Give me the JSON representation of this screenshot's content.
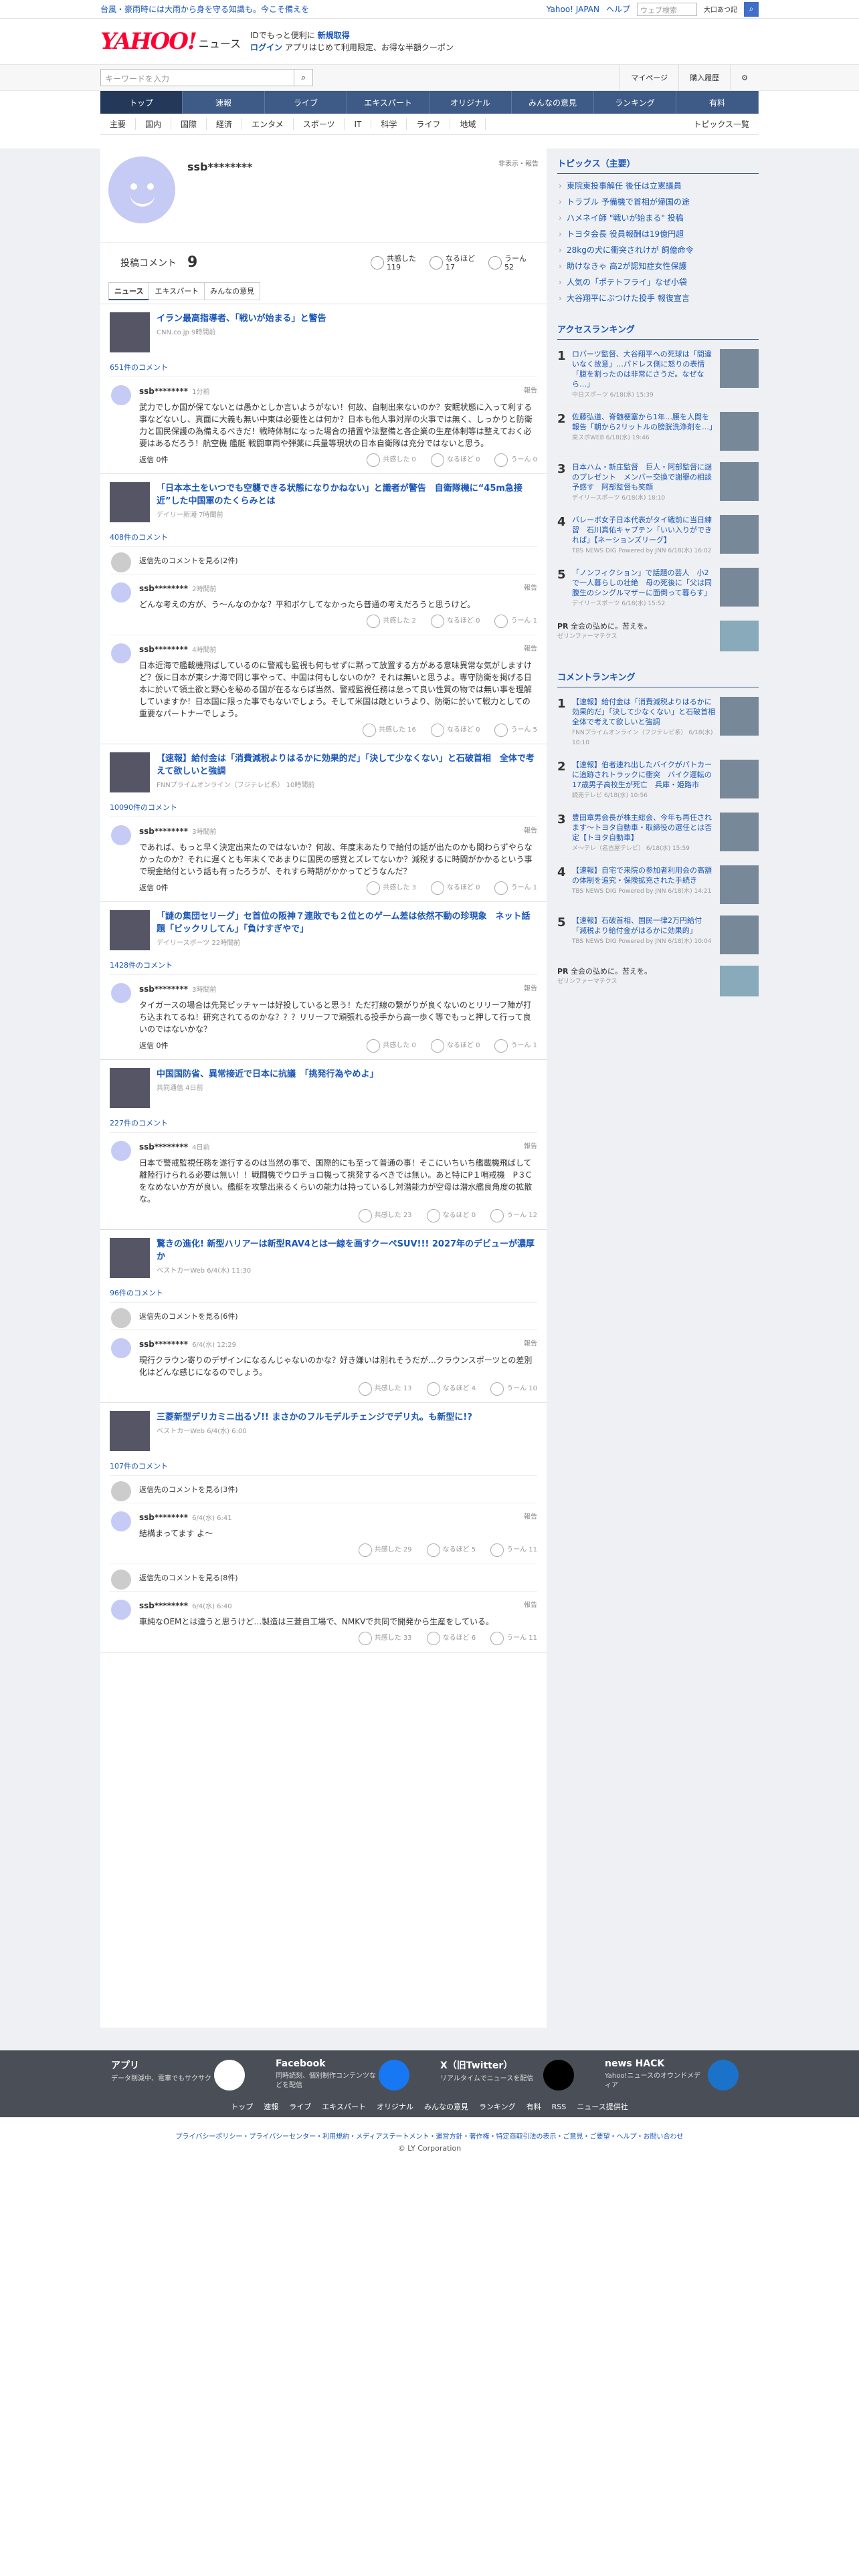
{
  "topbar": {
    "promo": "台風・豪雨時には大雨から身を守る知識も。今こそ備えを",
    "links": [
      "Yahoo! JAPAN",
      "ヘルプ"
    ],
    "search_placeholder": "ウェブ検索",
    "location": "大口あつ記"
  },
  "header": {
    "logo": "YAHOO!",
    "logo_sub": "ニュース",
    "msg1": "IDでもっと便利に",
    "msg1b": "新規取得",
    "msg2a": "ログイン",
    "msg2": "アプリはじめて利用限定、お得な半額クーポン"
  },
  "search": {
    "placeholder": "キーワードを入力",
    "mypage": "マイページ",
    "history": "購入履歴"
  },
  "nav1": [
    "トップ",
    "速報",
    "ライブ",
    "エキスパート",
    "オリジナル",
    "みんなの意見",
    "ランキング",
    "有料"
  ],
  "nav2": [
    "主要",
    "国内",
    "国際",
    "経済",
    "エンタメ",
    "スポーツ",
    "IT",
    "科学",
    "ライフ",
    "地域"
  ],
  "nav2_last": "トピックス一覧",
  "profile": {
    "name": "ssb********",
    "flag": "非表示・報告",
    "count_label": "投稿コメント",
    "count": "9",
    "empathy": {
      "label": "共感した",
      "value": "119"
    },
    "naruhodo": {
      "label": "なるほど",
      "value": "17"
    },
    "uun": {
      "label": "うーん",
      "value": "52"
    }
  },
  "tabs": [
    "ニュース",
    "エキスパート",
    "みんなの意見"
  ],
  "items": [
    {
      "title": "イラン最高指導者、「戦いが始まる」と警告",
      "src": "CNN.co.jp 9時間前",
      "count": "651件のコメント",
      "comments": [
        {
          "user": "ssb********",
          "time": "1分前",
          "report": "報告",
          "text": "武力でしか国が保てないとは愚かとしか言いようがない！何故、自制出来ないのか？安眠状態に入って利する事などないし、真面に大義も無い中東は必要性とは何か？日本も他人事対岸の火事では無く、しっかりと防衛力と国民保護の為備えるべきだ！戦時体制になった場合の措置や法整備と各企業の生産体制等は整えておく必要はあるだろう！航空機 艦艇 戦闘車両や弾薬に兵量等現状の日本自衛隊は充分ではないと思う。",
          "reply": "返信 0件",
          "r": [
            "共感した 0",
            "なるほど 0",
            "うーん 0"
          ]
        }
      ]
    },
    {
      "title": "「日本本土をいつでも空襲できる状態になりかねない」と識者が警告　自衛隊機に“45m急接近”した中国軍のたくらみとは",
      "src": "デイリー新潮 7時間前",
      "count": "408件のコメント",
      "hidden": "返信先のコメントを見る(2件)",
      "comments": [
        {
          "user": "ssb********",
          "time": "2時間前",
          "report": "報告",
          "text": "どんな考えの方が、う〜んなのかな？平和ボケしてなかったら普通の考えだろうと思うけど。",
          "reply": "",
          "r": [
            "共感した 2",
            "なるほど 0",
            "うーん 1"
          ]
        },
        {
          "user": "ssb********",
          "time": "4時間前",
          "report": "報告",
          "text": "日本近海で艦載機飛ばしているのに警戒も監視も何もせずに黙って放置する方がある意味異常な気がしますけど？仮に日本が東シナ海で同じ事やって、中国は何もしないのか？それは無いと思うよ。専守防衛を掲げる日本に於いて領土欲と野心を秘める国が在るならば当然、警戒監視任務は怠って良い性質の物では無い事を理解していますか！日本国に限った事でもないでしょう。そして米国は敵というより、防衛に於いて戦力としての重要なパートナーでしょう。",
          "reply": "",
          "r": [
            "共感した 16",
            "なるほど 0",
            "うーん 5"
          ]
        }
      ]
    },
    {
      "title": "【速報】給付金は「消費減税よりはるかに効果的だ」「決して少なくない」と石破首相　全体で考えて欲しいと強調",
      "src": "FNNプライムオンライン（フジテレビ系） 10時間前",
      "count": "10090件のコメント",
      "comments": [
        {
          "user": "ssb********",
          "time": "3時間前",
          "report": "報告",
          "text": "であれば、もっと早く決定出来たのではないか？何故、年度末あたりで給付の話が出たのかも関わらずやらなかったのか？それに遅くとも年末くであまりに国民の感覚とズレてないか？減税するに時間がかかるという事で現金給付という話も有ったろうが、それすら時期がかかってどうなんだ？",
          "reply": "返信 0件",
          "r": [
            "共感した 3",
            "なるほど 0",
            "うーん 1"
          ]
        }
      ]
    },
    {
      "title": "「謎の集団セリーグ」セ首位の阪神７連敗でも２位とのゲーム差は依然不動の珍現象　ネット話題「ビックリしてん」「負けすぎやで」",
      "src": "デイリースポーツ 22時間前",
      "count": "1428件のコメント",
      "comments": [
        {
          "user": "ssb********",
          "time": "3時間前",
          "report": "報告",
          "text": "タイガースの場合は先発ピッチャーは好投していると思う！ただ打線の繋がりが良くないのとリリーフ陣が打ち込まれてるね！研究されてるのかな？？？リリーフで頑張れる投手から高一歩く等でもっと押して行って良いのではないかな？",
          "reply": "返信 0件",
          "r": [
            "共感した 0",
            "なるほど 0",
            "うーん 1"
          ]
        }
      ]
    },
    {
      "title": "中国国防省、異常接近で日本に抗議　「挑発行為やめよ」",
      "src": "共同通信 4日前",
      "count": "227件のコメント",
      "comments": [
        {
          "user": "ssb********",
          "time": "4日前",
          "report": "報告",
          "text": "日本で警戒監視任務を遂行するのは当然の事で、国際的にも至って普通の事！そこにいちいち艦載機飛ばして離陸行けられる必要は無い！！戦闘機でウロチョロ機って挑発するべきでは無い。あと特にP１哨戒機　P３Cをなめないか方が良い。艦艇を攻撃出来るくらいの能力は持っているし対潜能力が空母は潜水艦良角度の拡散な。",
          "reply": "",
          "r": [
            "共感した 23",
            "なるほど 0",
            "うーん 12"
          ]
        }
      ]
    },
    {
      "title": "驚きの進化! 新型ハリアーは新型RAV4とは一線を画すクーペSUV!!! 2027年のデビューが濃厚か",
      "src": "ベストカーWeb 6/4(水) 11:30",
      "count": "96件のコメント",
      "hidden": "返信先のコメントを見る(6件)",
      "comments": [
        {
          "user": "ssb********",
          "time": "6/4(水) 12:29",
          "report": "報告",
          "text": "現行クラウン寄りのデザインになるんじゃないのかな？好き嫌いは別れそうだが…クラウンスポーツとの差別化はどんな感じになるのでしょう。",
          "reply": "",
          "r": [
            "共感した 13",
            "なるほど 4",
            "うーん 10"
          ]
        }
      ]
    },
    {
      "title": "三菱新型デリカミニ出るゾ!! まさかのフルモデルチェンジでデリ丸。も新型に!?",
      "src": "ベストカーWeb 6/4(水) 6:00",
      "count": "107件のコメント",
      "hidden": "返信先のコメントを見る(3件)",
      "comments": [
        {
          "user": "ssb********",
          "time": "6/4(水) 6:41",
          "report": "報告",
          "text": "結構まってます よ〜",
          "reply": "",
          "r": [
            "共感した 29",
            "なるほど 5",
            "うーん 11"
          ]
        }
      ],
      "hidden2": "返信先のコメントを見る(8件)",
      "comments2": [
        {
          "user": "ssb********",
          "time": "6/4(水) 6:40",
          "report": "報告",
          "text": "車純なOEMとは違うと思うけど…製造は三菱自工場で、NMKVで共同で開発から生産をしている。",
          "reply": "",
          "r": [
            "共感した 33",
            "なるほど 6",
            "うーん 11"
          ]
        }
      ]
    }
  ],
  "side": {
    "topics_title": "トピックス（主要）",
    "topics": [
      "東院東投事解任 後任は立憲議員",
      "トラブル 予備機で首相が帰国の途",
      "ハメネイ師 \"戦いが始まる\" 投稿",
      "トヨタ会長 役員報酬は19億円超",
      "28kgの犬に衝突されけが 飼億命令",
      "助けなきゃ 高2が認知症女性保護",
      "人気の「ポテトフライ」なぜ小袋",
      "大谷翔平にぶつけた投手 報復宣言"
    ],
    "access_title": "アクセスランキング",
    "access": [
      {
        "n": "1",
        "t": "ロバーツ監督、大谷翔平への死球は「間違いなく故意」…パドレス側に怒りの表情「腹を割ったのは非常にさうだ。なぜなら…」",
        "s": "中日スポーツ 6/18(水) 15:39"
      },
      {
        "n": "2",
        "t": "佐藤弘道、脊髄梗塞から1年…腰を人間を報告「朝から2リットルの膀胱洗浄剤を…」",
        "s": "東スポWEB 6/18(水) 19:46"
      },
      {
        "n": "3",
        "t": "日本ハム・新庄監督　巨人・阿部監督に謎のプレゼント　メンバー交換で謝罪の相談予感す　阿部監督も笑顔",
        "s": "デイリースポーツ 6/18(水) 18:10"
      },
      {
        "n": "4",
        "t": "バレーボ女子日本代表がタイ戦前に当日練習　石川真佑キャプテン「いい入りができれば」【ネーションズリーグ】",
        "s": "TBS NEWS DIG Powered by JNN 6/18(水) 16:02"
      },
      {
        "n": "5",
        "t": "「ノンフィクション」で話題の芸人　小2で一人暮らしの壮絶　母の死後に「父は同腹生のシングルマザーに面倒って暮らす」",
        "s": "デイリースポーツ 6/18(水) 15:52"
      }
    ],
    "pr1": "全会の弘めに。苦えを。",
    "pr1s": "ゼリンファーマテクス",
    "comment_title": "コメントランキング",
    "cranks": [
      {
        "n": "1",
        "t": "【速報】給付金は「消費減税よりはるかに効果的だ」「決して少なくない」と石破首相　全体で考えて欲しいと強調",
        "s": "FNNプライムオンライン（フジテレビ系） 6/18(水) 10:10"
      },
      {
        "n": "2",
        "t": "【速報】伯者連れ出したバイクがパトカーに追跡されトラックに衝突　バイク運転の17歳男子高校生が死亡　兵庫・姫路市",
        "s": "読売テレビ 6/18(水) 10:56"
      },
      {
        "n": "3",
        "t": "豊田章男会長が株主総会、今年も再任されます〜トヨタ自動車・取締役の選任とは否定【トヨタ自動車】",
        "s": "メ〜テレ（名古屋テレビ） 6/18(水) 15:59"
      },
      {
        "n": "4",
        "t": "【速報】自宅で来院の参加者利用会の高額の体制を追究・保険拡充された手続き",
        "s": "TBS NEWS DIG Powered by JNN 6/18(水) 14:21"
      },
      {
        "n": "5",
        "t": "【速報】石破首相、国民一律2万円給付「減税より給付金がはるかに効果的」",
        "s": "TBS NEWS DIG Powered by JNN 6/18(水) 10:04"
      }
    ],
    "pr2": "全会の弘めに。苦えを。",
    "pr2s": "ゼリンファーマテクス"
  },
  "footer": {
    "cards": [
      {
        "h": "アプリ",
        "d": "データ削減中、電車でもサクサク"
      },
      {
        "h": "Facebook",
        "d": "同時読刻、個別制作コンテンツなどを配信"
      },
      {
        "h": "X（旧Twitter）",
        "d": "リアルタイムでニュースを配信"
      },
      {
        "h": "news HACK",
        "d": "Yahoo!ニュースのオウンドメディア"
      }
    ],
    "links": [
      "トップ",
      "速報",
      "ライブ",
      "エキスパート",
      "オリジナル",
      "みんなの意見",
      "ランキング",
      "有料",
      "RSS",
      "ニュース提供社"
    ],
    "legal": "プライバシーポリシー・プライバシーセンター・利用規約・メディアステートメント・運営方針・著作権・特定商取引法の表示・ご意見・ご要望・ヘルプ・お問い合わせ",
    "copy": "© LY Corporation"
  },
  "colors": {
    "nav": "#3d5b86",
    "link": "#1a56b8",
    "brand": "#ff0033"
  }
}
